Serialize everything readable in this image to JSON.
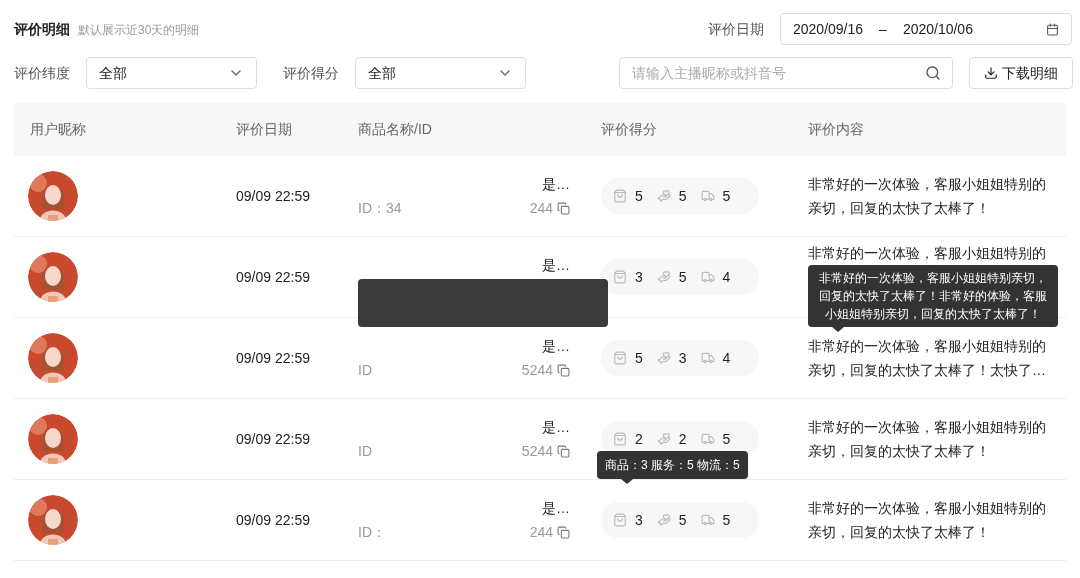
{
  "header": {
    "title": "评价明细",
    "subtitle": "默认展示近30天的明细",
    "date_label": "评价日期",
    "date_start": "2020/09/16",
    "date_separator": "–",
    "date_end": "2020/10/06"
  },
  "filters": [
    {
      "label": "评价纬度",
      "value": "全部"
    },
    {
      "label": "评价得分",
      "value": "全部"
    }
  ],
  "search": {
    "placeholder": "请输入主播昵称或抖音号"
  },
  "download_button": "下载明细",
  "table": {
    "columns": [
      "用户昵称",
      "评价日期",
      "商品名称/ID",
      "评价得分",
      "评价内容"
    ],
    "rows": [
      {
        "date": "09/09 22:59",
        "product_name": "是…",
        "id_label": "ID：34",
        "id_value": "244",
        "scores": [
          "5",
          "5",
          "5"
        ],
        "comment": "非常好的一次体验，客服小姐姐特别的亲切，回复的太快了太棒了！"
      },
      {
        "date": "09/09 22:59",
        "product_name": "是…",
        "scores": [
          "3",
          "5",
          "4"
        ],
        "comment": "非常好的一次体验，客服小姐姐特别的",
        "product_popup": {
          "kind": "blank"
        },
        "comment_tooltip": "非常好的一次体验，客服小姐姐特别亲切，回复的太快了太棒了！非常好的体验，客服小姐姐特别亲切，回复的太快了太棒了！"
      },
      {
        "date": "09/09 22:59",
        "product_name": "是…",
        "id_label": "ID",
        "id_value": "5244",
        "scores": [
          "5",
          "3",
          "4"
        ],
        "comment": "非常好的一次体验，客服小姐姐特别的亲切，回复的太快了太棒了！太快了…"
      },
      {
        "date": "09/09 22:59",
        "product_name": "是…",
        "id_label": "ID",
        "id_value": "5244",
        "scores": [
          "2",
          "2",
          "5"
        ],
        "comment": "非常好的一次体验，客服小姐姐特别的亲切，回复的太快了太棒了！"
      },
      {
        "date": "09/09 22:59",
        "product_name": "是…",
        "id_label": "ID：",
        "id_value": "244",
        "scores": [
          "3",
          "5",
          "5"
        ],
        "comment": "非常好的一次体验，客服小姐姐特别的亲切，回复的太快了太棒了！",
        "score_tooltip": "商品：3 服务：5 物流：5"
      }
    ]
  }
}
